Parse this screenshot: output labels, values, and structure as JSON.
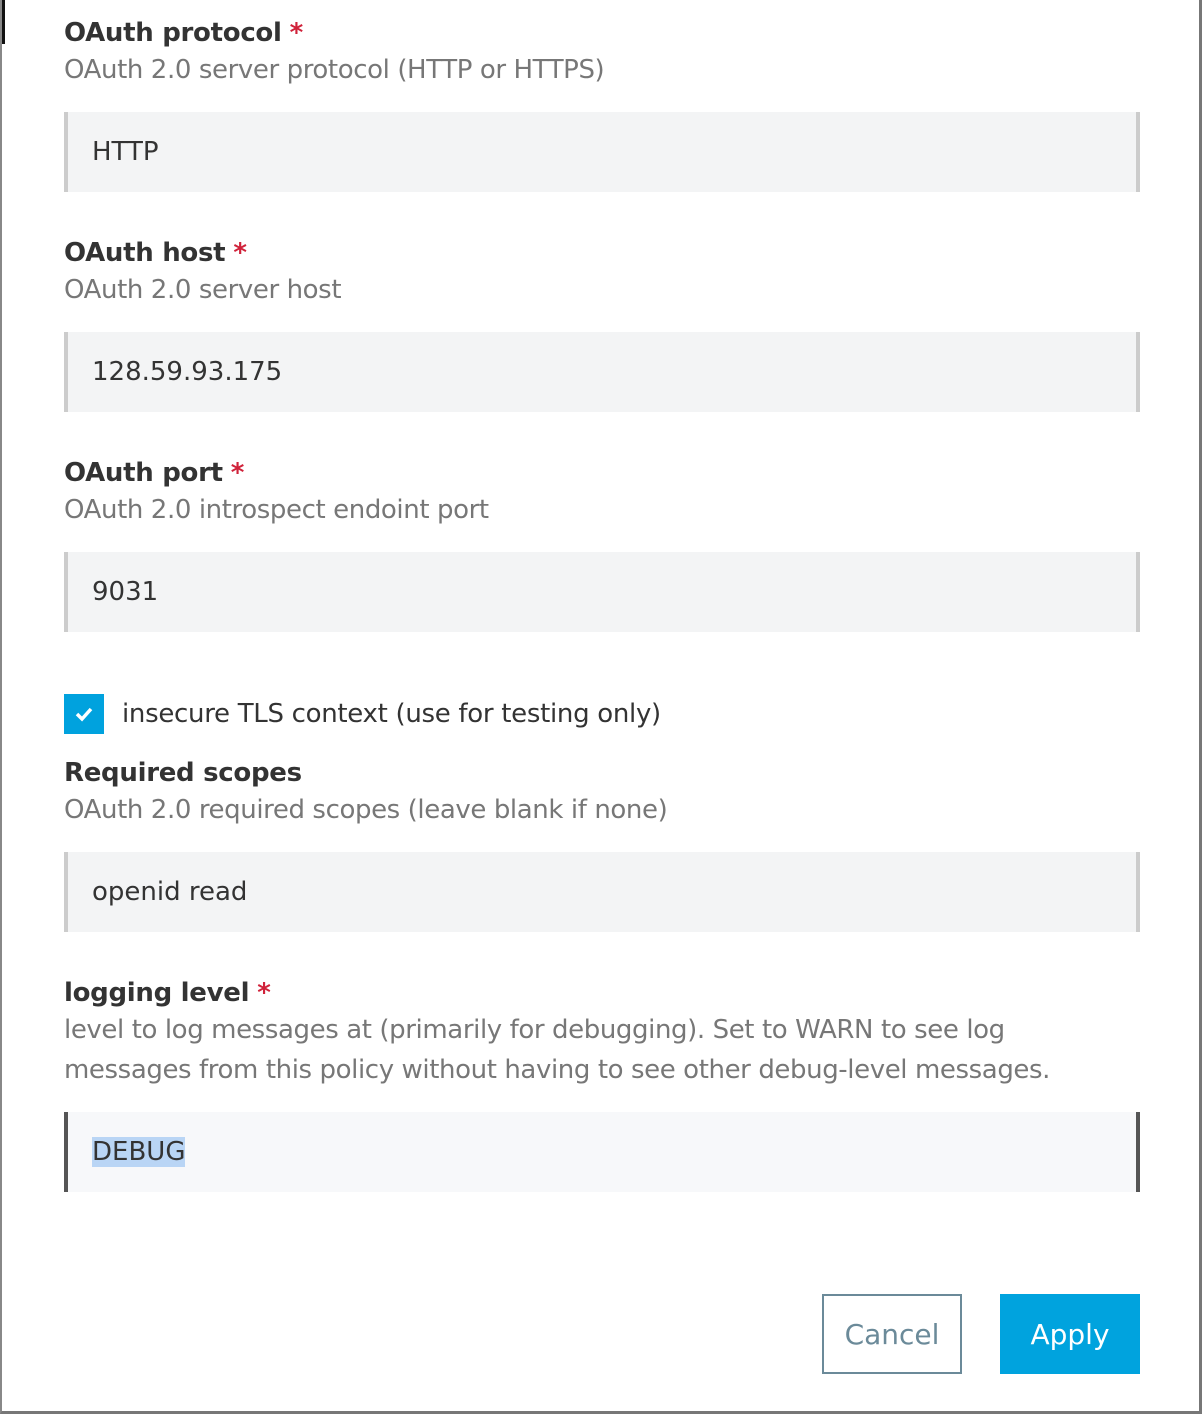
{
  "fields": [
    {
      "label": "OAuth protocol",
      "required": "*",
      "help": "OAuth 2.0 server protocol (HTTP or HTTPS)",
      "value": "HTTP"
    },
    {
      "label": "OAuth host",
      "required": "*",
      "help": "OAuth 2.0 server host",
      "value": "128.59.93.175"
    },
    {
      "label": "OAuth port",
      "required": "*",
      "help": "OAuth 2.0 introspect endoint port",
      "value": "9031"
    },
    {
      "label": "Required scopes",
      "help": "OAuth 2.0 required scopes (leave blank if none)",
      "value": "openid read"
    },
    {
      "label": "logging level",
      "required": "*",
      "help": "level to log messages at (primarily for debugging). Set to WARN to see log messages from this policy without having to see other debug-level messages.",
      "value": "DEBUG"
    }
  ],
  "checkbox": {
    "label": "insecure TLS context (use for testing only)",
    "checked": true
  },
  "buttons": {
    "cancel": "Cancel",
    "apply": "Apply"
  },
  "colors": {
    "accent": "#00a3de",
    "required": "#d0223a"
  }
}
